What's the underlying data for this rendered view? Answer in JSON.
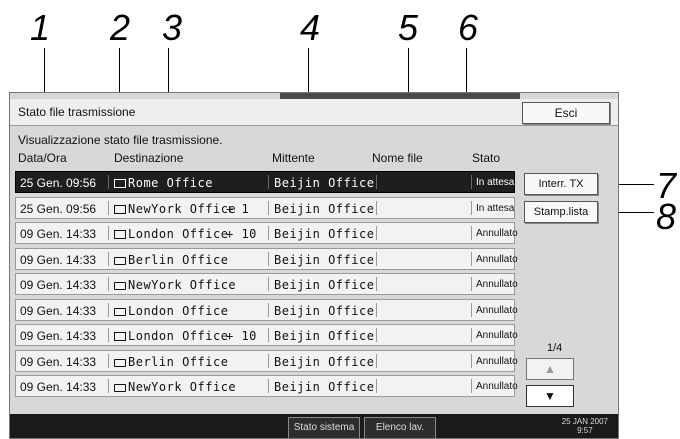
{
  "callouts": [
    "1",
    "2",
    "3",
    "4",
    "5",
    "6",
    "7",
    "8"
  ],
  "header": {
    "title": "Stato file trasmissione",
    "exit_label": "Esci"
  },
  "subtitle": "Visualizzazione stato file trasmissione.",
  "columns": {
    "date": "Data/Ora",
    "destination": "Destinazione",
    "sender": "Mittente",
    "file_name": "Nome file",
    "status": "Stato"
  },
  "rows": [
    {
      "date": "25 Gen. 09:56",
      "icon": "document-icon",
      "dest": "Rome Office",
      "extra": "",
      "sender": "Beijin Office",
      "status": "In attesa",
      "selected": true
    },
    {
      "date": "25 Gen. 09:56",
      "icon": "document-icon",
      "dest": "NewYork Office",
      "extra": "+ 1",
      "sender": "Beijin Office",
      "status": "In attesa",
      "selected": false
    },
    {
      "date": "09 Gen. 14:33",
      "icon": "document-icon",
      "dest": "London Office",
      "extra": "+ 10",
      "sender": "Beijin Office",
      "status": "Annullato",
      "selected": false
    },
    {
      "date": "09 Gen. 14:33",
      "icon": "folder-icon",
      "dest": "Berlin Office",
      "extra": "",
      "sender": "Beijin Office",
      "status": "Annullato",
      "selected": false
    },
    {
      "date": "09 Gen. 14:33",
      "icon": "folder-icon",
      "dest": "NewYork Office",
      "extra": "",
      "sender": "Beijin Office",
      "status": "Annullato",
      "selected": false
    },
    {
      "date": "09 Gen. 14:33",
      "icon": "folder-icon",
      "dest": "London Office",
      "extra": "",
      "sender": "Beijin Office",
      "status": "Annullato",
      "selected": false
    },
    {
      "date": "09 Gen. 14:33",
      "icon": "document-icon",
      "dest": "London Office",
      "extra": "+ 10",
      "sender": "Beijin Office",
      "status": "Annullato",
      "selected": false
    },
    {
      "date": "09 Gen. 14:33",
      "icon": "folder-icon",
      "dest": "Berlin Office",
      "extra": "",
      "sender": "Beijin Office",
      "status": "Annullato",
      "selected": false
    },
    {
      "date": "09 Gen. 14:33",
      "icon": "folder-icon",
      "dest": "NewYork Office",
      "extra": "",
      "sender": "Beijin Office",
      "status": "Annullato",
      "selected": false
    }
  ],
  "side": {
    "interrupt_label": "Interr. TX",
    "print_list_label": "Stamp.lista",
    "page": "1/4",
    "up_arrow": "▲",
    "down_arrow": "▼"
  },
  "bottom": {
    "system_status": "Stato sistema",
    "job_list": "Elenco lav.",
    "date": "25 JAN  2007",
    "time": "9:57"
  }
}
